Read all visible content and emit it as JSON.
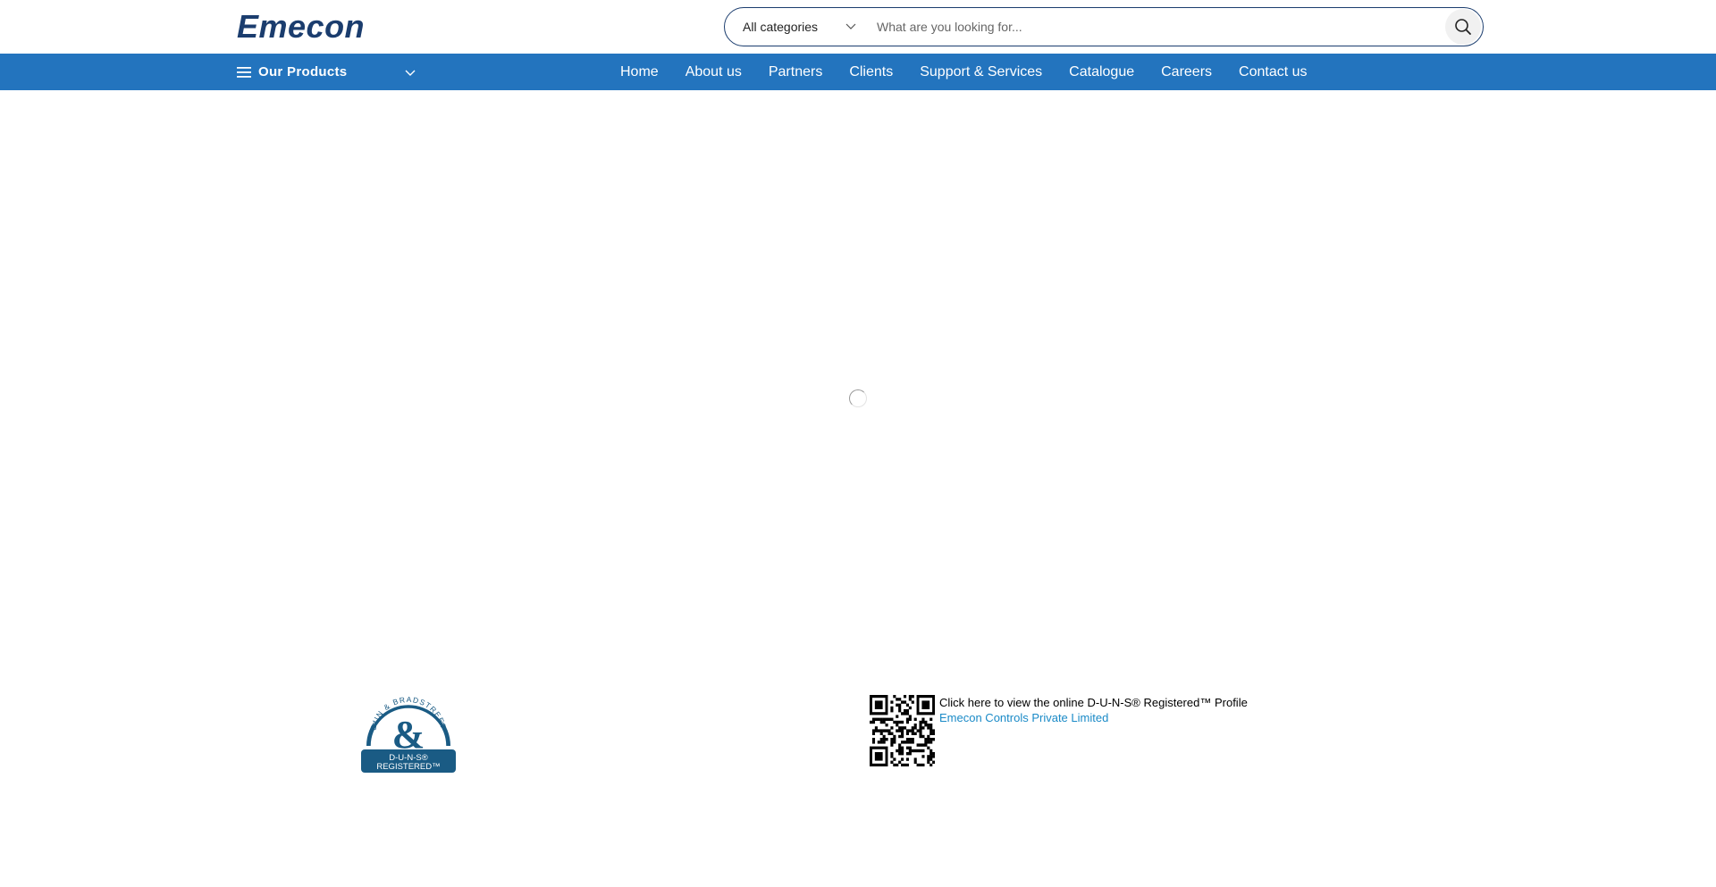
{
  "header": {
    "logo_text": "Emecon",
    "brand_color": "#1b3d6e",
    "search": {
      "category_selected": "All categories",
      "placeholder": "What are you looking for...",
      "value": ""
    }
  },
  "navbar": {
    "background": "#2374be",
    "products_label": "Our Products",
    "links": [
      {
        "label": "Home"
      },
      {
        "label": "About us"
      },
      {
        "label": "Partners"
      },
      {
        "label": "Clients"
      },
      {
        "label": "Support & Services"
      },
      {
        "label": "Catalogue"
      },
      {
        "label": "Careers"
      },
      {
        "label": "Contact us"
      }
    ]
  },
  "main": {
    "state": "loading"
  },
  "footer": {
    "duns_badge": {
      "arc_text": "DUN & BRADSTREET",
      "symbol": "&",
      "line1": "D-U-N-S®",
      "line2": "REGISTERED™"
    },
    "duns_profile": {
      "line1": "Click here to view the online D-U-N-S® Registered™ Profile",
      "line2": "Emecon Controls Private Limited"
    }
  }
}
